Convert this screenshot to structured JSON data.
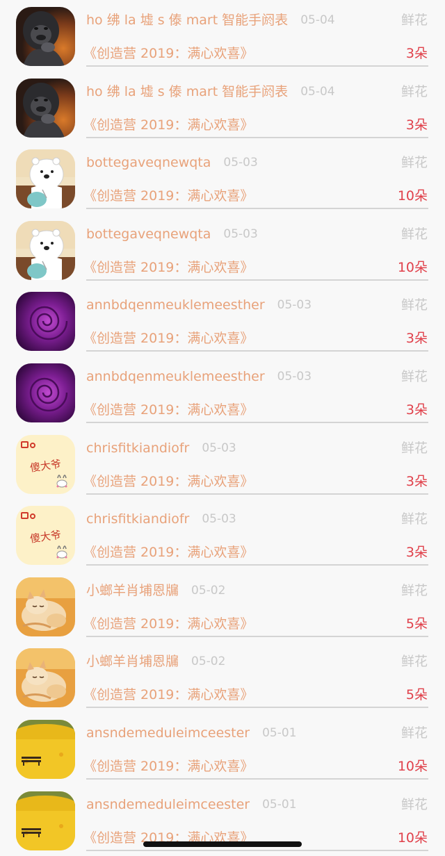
{
  "gift_label": "鲜花",
  "program_title": "《创造营 2019：满心欢喜》",
  "rows": [
    {
      "avatar": "gorilla-avatar",
      "name": "ho 绋 la 墟 s 傣 mart 智能手阏表",
      "date": "05-04",
      "count": "3朵"
    },
    {
      "avatar": "gorilla-avatar",
      "name": "ho 绋 la 墟 s 傣 mart 智能手阏表",
      "date": "05-04",
      "count": "3朵"
    },
    {
      "avatar": "polar-bear-avatar",
      "name": "bottegaveqnewqta",
      "date": "05-03",
      "count": "10朵"
    },
    {
      "avatar": "polar-bear-avatar",
      "name": "bottegaveqnewqta",
      "date": "05-03",
      "count": "10朵"
    },
    {
      "avatar": "purple-rose-avatar",
      "name": "annbdqenmeuklemeesther",
      "date": "05-03",
      "count": "3朵"
    },
    {
      "avatar": "purple-rose-avatar",
      "name": "annbdqenmeuklemeesther",
      "date": "05-03",
      "count": "3朵"
    },
    {
      "avatar": "sticker-avatar",
      "name": "chrisfitkiandiofr",
      "date": "05-03",
      "count": "3朵"
    },
    {
      "avatar": "sticker-avatar",
      "name": "chrisfitkiandiofr",
      "date": "05-03",
      "count": "3朵"
    },
    {
      "avatar": "cat-avatar",
      "name": "小螂羊肖埔恩牖",
      "date": "05-02",
      "count": "5朵"
    },
    {
      "avatar": "cat-avatar",
      "name": "小螂羊肖埔恩牖",
      "date": "05-02",
      "count": "5朵"
    },
    {
      "avatar": "autumn-bench-avatar",
      "name": "ansndemeduleimceester",
      "date": "05-01",
      "count": "10朵"
    },
    {
      "avatar": "autumn-bench-avatar",
      "name": "ansndemeduleimceester",
      "date": "05-01",
      "count": "10朵"
    }
  ],
  "sticker_text": "傻大爷",
  "colors": {
    "name": "#e8a27a",
    "date": "#c8c8c8",
    "count": "#e0404a",
    "divider": "#d4d4d4",
    "background": "#f8f8f8"
  }
}
